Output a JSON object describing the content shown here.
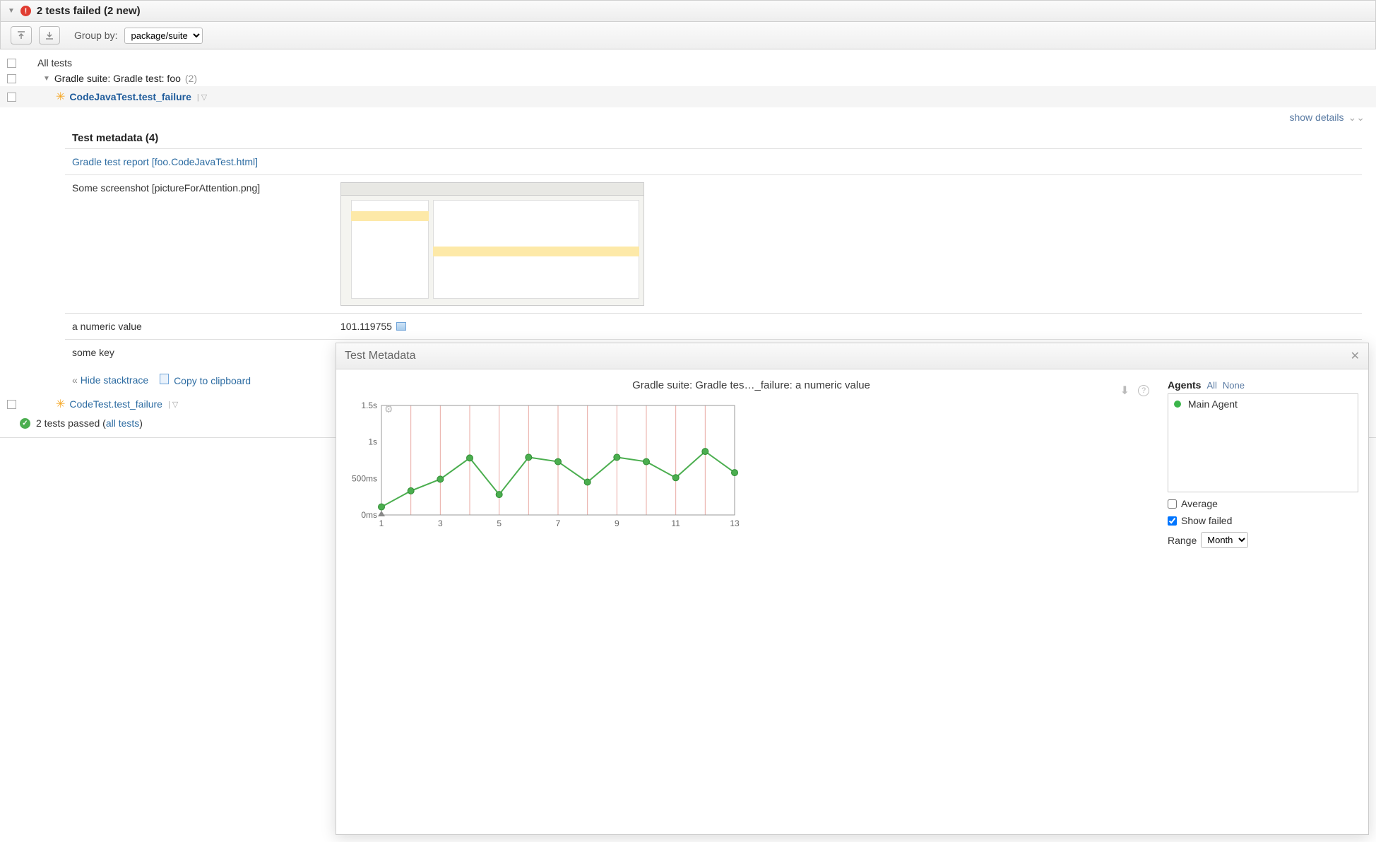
{
  "header": {
    "title": "2 tests failed (2 new)"
  },
  "toolbar": {
    "group_by_label": "Group by:",
    "group_by_value": "package/suite"
  },
  "tree": {
    "all_tests": "All tests",
    "suite": "Gradle suite: Gradle test: foo",
    "suite_count": "(2)",
    "test1": "CodeJavaTest.test_failure",
    "test2": "CodeTest.test_failure"
  },
  "details": {
    "show_details": "show details"
  },
  "metadata": {
    "title": "Test metadata (4)",
    "report_link": "Gradle test report [foo.CodeJavaTest.html]",
    "screenshot_label": "Some screenshot [pictureForAttention.png]",
    "numeric_key": "a numeric value",
    "numeric_val": "101.119755",
    "some_key": "some key"
  },
  "stacktrace": {
    "hide_prefix": "«",
    "hide": "Hide stacktrace",
    "copy": "Copy to clipboard"
  },
  "passed": {
    "text": "2 tests passed (",
    "link": "all tests",
    "suffix": ")"
  },
  "panel": {
    "title": "Test Metadata",
    "chart_title": "Gradle suite: Gradle tes…_failure: a numeric value",
    "agents_title": "Agents",
    "agents_all": "All",
    "agents_none": "None",
    "agent1": "Main Agent",
    "average": "Average",
    "show_failed": "Show failed",
    "range_label": "Range",
    "range_value": "Month"
  },
  "chart_data": {
    "type": "line",
    "title": "Gradle suite: Gradle tes…_failure: a numeric value",
    "xlabel": "",
    "ylabel": "",
    "x": [
      1,
      2,
      3,
      4,
      5,
      6,
      7,
      8,
      9,
      10,
      11,
      12,
      13
    ],
    "values_ms": [
      110,
      330,
      490,
      780,
      280,
      790,
      730,
      450,
      790,
      730,
      510,
      870,
      580
    ],
    "y_ticks": [
      "0ms",
      "500ms",
      "1s",
      "1.5s"
    ],
    "x_ticks": [
      1,
      3,
      5,
      7,
      9,
      11,
      13
    ],
    "ylim_ms": [
      0,
      1500
    ]
  }
}
